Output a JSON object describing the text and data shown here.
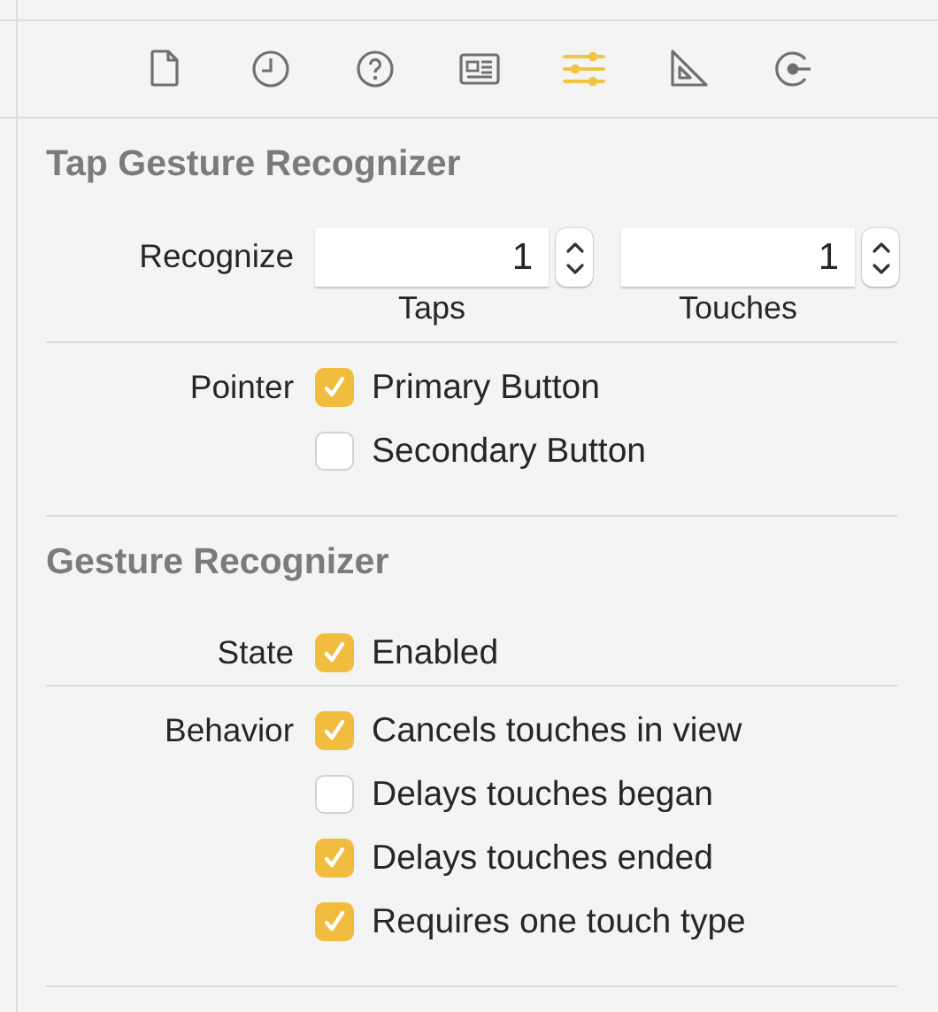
{
  "toolbar": {
    "tabs": [
      {
        "kind": "file",
        "selected": false
      },
      {
        "kind": "clock",
        "selected": false
      },
      {
        "kind": "help",
        "selected": false
      },
      {
        "kind": "panel",
        "selected": false
      },
      {
        "kind": "sliders",
        "selected": true
      },
      {
        "kind": "ruler",
        "selected": false
      },
      {
        "kind": "connection",
        "selected": false
      }
    ]
  },
  "sections": [
    {
      "title": "Tap Gesture Recognizer",
      "groups": [
        {
          "kind": "steppers",
          "label": "Recognize",
          "fields": [
            {
              "value": "1",
              "caption": "Taps"
            },
            {
              "value": "1",
              "caption": "Touches"
            }
          ]
        },
        {
          "kind": "checkboxes",
          "label": "Pointer",
          "options": [
            {
              "label": "Primary Button",
              "checked": true
            },
            {
              "label": "Secondary Button",
              "checked": false
            }
          ]
        }
      ]
    },
    {
      "title": "Gesture Recognizer",
      "groups": [
        {
          "kind": "checkboxes",
          "label": "State",
          "options": [
            {
              "label": "Enabled",
              "checked": true
            }
          ]
        },
        {
          "kind": "checkboxes",
          "label": "Behavior",
          "options": [
            {
              "label": "Cancels touches in view",
              "checked": true
            },
            {
              "label": "Delays touches began",
              "checked": false
            },
            {
              "label": "Delays touches ended",
              "checked": true
            },
            {
              "label": "Requires one touch type",
              "checked": true
            }
          ]
        }
      ]
    }
  ]
}
